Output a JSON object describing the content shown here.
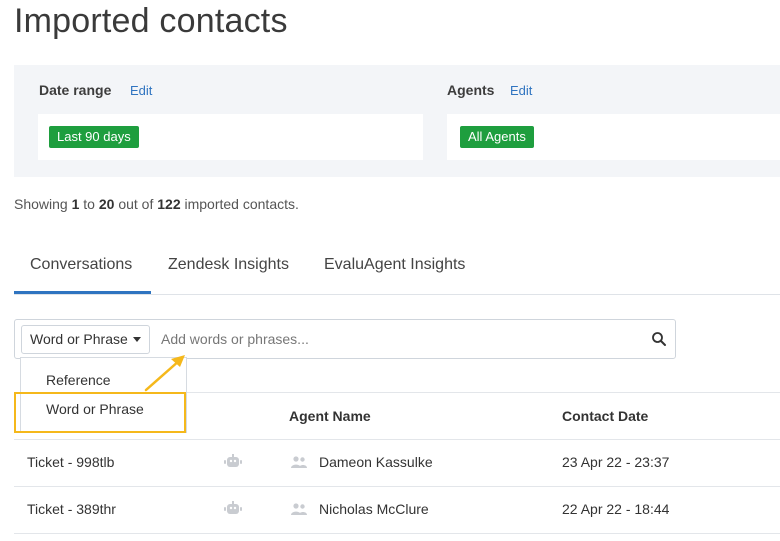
{
  "page": {
    "title": "Imported contacts"
  },
  "filters": {
    "date_range": {
      "label": "Date range",
      "edit": "Edit",
      "value": "Last 90 days"
    },
    "agents": {
      "label": "Agents",
      "edit": "Edit",
      "value": "All Agents"
    }
  },
  "summary": {
    "prefix": "Showing",
    "from": "1",
    "to_word": "to",
    "to": "20",
    "out_of": "out of",
    "total": "122",
    "suffix": "imported contacts."
  },
  "tabs": [
    {
      "label": "Conversations",
      "active": true
    },
    {
      "label": "Zendesk Insights",
      "active": false
    },
    {
      "label": "EvaluAgent Insights",
      "active": false
    }
  ],
  "search": {
    "type_selected": "Word or Phrase",
    "placeholder": "Add words or phrases...",
    "icon": "search-icon",
    "dropdown_options": [
      "Reference",
      "Word or Phrase"
    ]
  },
  "table": {
    "headers": {
      "agent_name": "Agent Name",
      "contact_date": "Contact Date"
    },
    "rows": [
      {
        "ticket": "Ticket - 998tlb",
        "agent": "Dameon Kassulke",
        "date": "23 Apr 22 - 23:37"
      },
      {
        "ticket": "Ticket - 389thr",
        "agent": "Nicholas McClure",
        "date": "22 Apr 22 - 18:44"
      }
    ]
  },
  "colors": {
    "accent": "#2f74c0",
    "tag_green": "#1e9e3e",
    "highlight": "#f5b81b",
    "panel": "#f3f5f8"
  }
}
